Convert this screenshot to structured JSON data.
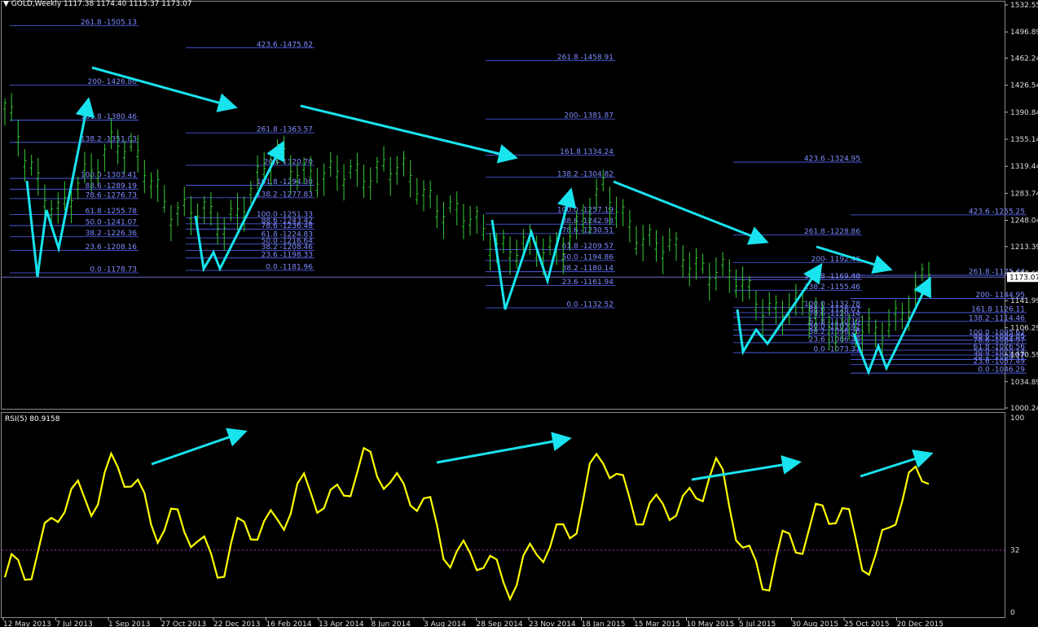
{
  "header": {
    "symbol": "GOLD,Weekly",
    "ohlc": "1117.38 1174.40 1115.37 1173.07"
  },
  "rsi_header": {
    "name": "RSI(5)",
    "value": "80.9158"
  },
  "colors": {
    "background": "#000000",
    "bull": "#33cc33",
    "arrow": "#19e3ee",
    "fib": "#5566ff",
    "rsi": "#ffff00",
    "current": "#8c8cff"
  },
  "price_axis": {
    "ticks": [
      "1532.55",
      "1496.89",
      "1462.24",
      "1426.54",
      "1390.84",
      "1355.14",
      "1319.44",
      "1283.74",
      "1248.04",
      "1213.39",
      "1177.69",
      "1141.99",
      "1106.29",
      "1070.59",
      "1034.89",
      "1000.24"
    ],
    "current": "1173.07"
  },
  "rsi_axis": {
    "ticks": [
      "100",
      "32",
      "0"
    ]
  },
  "dates": [
    "12 May 2013",
    "7 Jul 2013",
    "1 Sep 2013",
    "27 Oct 2013",
    "22 Dec 2013",
    "16 Feb 2014",
    "13 Apr 2014",
    "8 Jun 2014",
    "3 Aug 2014",
    "28 Sep 2014",
    "23 Nov 2014",
    "18 Jan 2015",
    "15 Mar 2015",
    "10 May 2015",
    "5 Jul 2015",
    "30 Aug 2015",
    "25 Oct 2015",
    "20 Dec 2015"
  ],
  "fib_groups": [
    {
      "levels": [
        "261.8 -1505.13",
        "200- 1426.80",
        "161.8 -1380.46",
        "138.2 -1351.03",
        "100.0 -1303.41",
        "88.6 -1289.19",
        "78.6 -1276.73",
        "61.8 -1255.78",
        "50.0 -1241.07",
        "38.2 -1226.36",
        "23.6 -1208.16",
        "0.0 -1178.73"
      ]
    },
    {
      "levels": [
        "423.6 -1475.82",
        "261.8 -1363.57",
        "200- 1320.70",
        "161.8 -1294.30",
        "138.2 -1277.83",
        "100.0 -1251.33",
        "88.6 -1243.42",
        "78.6 -1236.48",
        "61.8 -1224.83",
        "50.0 -1216.64",
        "38.2 -1208.46",
        "23.6 -1198.33",
        "0.0 -1181.96"
      ]
    },
    {
      "levels": [
        "261.8 -1458.91",
        "200- 1381.87",
        "161.8 1334.24",
        "138.2 -1304.82",
        "100.0 -1257.19",
        "88.6 -1242.98",
        "78.6 -1230.51",
        "61.8 -1209.57",
        "50.0 -1194.86",
        "38.2 -1180.14",
        "23.6 -1161.94",
        "0.0 -1132.52"
      ]
    },
    {
      "levels": [
        "423.6 -1324.95",
        "261.8 -1228.86",
        "200- 1192.46",
        "161.8 -1169.48",
        "138.2 -1155.46",
        "100.0 -1132.78",
        "88.6 -1126.07",
        "78.6 -1120.14",
        "61.8 -1110.19",
        "50.0 -1103.42",
        "38.2 -1096.26",
        "23.6 -1086.38",
        "0.0 -1073.31"
      ]
    },
    {
      "levels": [
        "423.6 -1255.25",
        "261.8 -1175.44",
        "200- 1144.95",
        "161.8 1126.11",
        "138.2 -1114.46",
        "100.0 -1095.62",
        "88.6 -1089.85",
        "78.6 -1084.97",
        "61.8 -1076.56",
        "50.0 -1070.14",
        "38.2 -1064.17",
        "23.6 -1057.49",
        "0.0 -1046.29"
      ]
    }
  ],
  "chart_data": {
    "type": "line",
    "title": "GOLD,Weekly",
    "price_range": [
      1000.24,
      1532.55
    ],
    "rsi_range": [
      0,
      100
    ],
    "rsi_level": 32,
    "x": [
      "12 May 2013",
      "7 Jul 2013",
      "1 Sep 2013",
      "27 Oct 2013",
      "22 Dec 2013",
      "16 Feb 2014",
      "13 Apr 2014",
      "8 Jun 2014",
      "3 Aug 2014",
      "28 Sep 2014",
      "23 Nov 2014",
      "18 Jan 2015",
      "15 Mar 2015",
      "10 May 2015",
      "5 Jul 2015",
      "30 Aug 2015",
      "25 Oct 2015",
      "20 Dec 2015"
    ],
    "series": [
      {
        "name": "GOLD,Weekly",
        "values": [
          1390,
          1250,
          1360,
          1270,
          1240,
          1330,
          1300,
          1320,
          1270,
          1220,
          1200,
          1280,
          1210,
          1185,
          1135,
          1120,
          1090,
          1173
        ]
      },
      {
        "name": "RSI(5)",
        "values": [
          12,
          50,
          73,
          45,
          28,
          52,
          62,
          76,
          40,
          18,
          30,
          77,
          46,
          72,
          15,
          55,
          28,
          80.9
        ]
      }
    ]
  }
}
